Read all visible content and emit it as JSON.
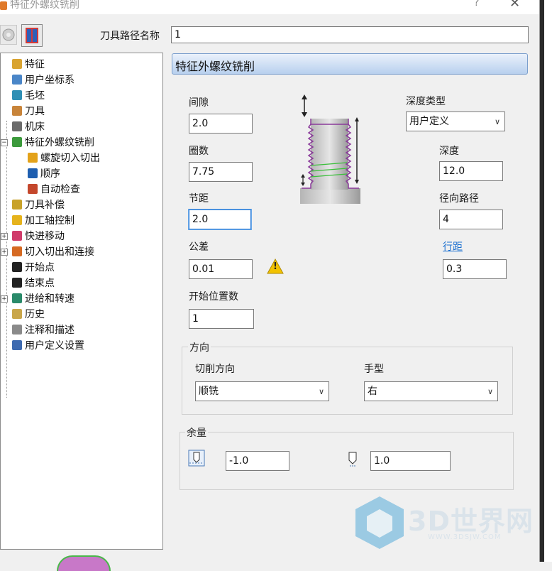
{
  "window": {
    "title": "特征外螺纹铣削",
    "help_glyph": "?",
    "close_glyph": "✕"
  },
  "toolpath_name": {
    "label": "刀具路径名称",
    "value": "1"
  },
  "tree": {
    "items": [
      {
        "label": "特征",
        "icon": "feature-icon",
        "color": "#d9a431"
      },
      {
        "label": "用户坐标系",
        "icon": "ucs-icon",
        "color": "#4a86c8"
      },
      {
        "label": "毛坯",
        "icon": "stock-icon",
        "color": "#2f8fb5"
      },
      {
        "label": "刀具",
        "icon": "tool-icon",
        "color": "#c8843a"
      },
      {
        "label": "机床",
        "icon": "machine-icon",
        "color": "#6b6b6b"
      },
      {
        "label": "特征外螺纹铣削",
        "icon": "thread-milling-icon",
        "color": "#3c9a3c"
      },
      {
        "label": "螺旋切入切出",
        "icon": "helix-lead-icon",
        "color": "#e3a21a"
      },
      {
        "label": "顺序",
        "icon": "order-icon",
        "color": "#1f5fb0"
      },
      {
        "label": "自动检查",
        "icon": "auto-check-icon",
        "color": "#c4472c"
      },
      {
        "label": "刀具补偿",
        "icon": "tool-comp-icon",
        "color": "#c8a22a"
      },
      {
        "label": "加工轴控制",
        "icon": "axis-control-icon",
        "color": "#e6b31c"
      },
      {
        "label": "快进移动",
        "icon": "rapid-move-icon",
        "color": "#d03b6a"
      },
      {
        "label": "切入切出和连接",
        "icon": "leads-links-icon",
        "color": "#d66a22"
      },
      {
        "label": "开始点",
        "icon": "start-point-icon",
        "color": "#222222"
      },
      {
        "label": "结束点",
        "icon": "end-point-icon",
        "color": "#222222"
      },
      {
        "label": "进给和转速",
        "icon": "feeds-speeds-icon",
        "color": "#2a8a6a"
      },
      {
        "label": "历史",
        "icon": "history-icon",
        "color": "#c9a64a"
      },
      {
        "label": "注释和描述",
        "icon": "notes-icon",
        "color": "#8a8a8a"
      },
      {
        "label": "用户定义设置",
        "icon": "user-settings-icon",
        "color": "#3d6ab0"
      }
    ]
  },
  "panel": {
    "header": "特征外螺纹铣削",
    "clearance": {
      "label": "间隙",
      "value": "2.0"
    },
    "turns": {
      "label": "圈数",
      "value": "7.75"
    },
    "pitch": {
      "label": "节距",
      "value": "2.0"
    },
    "tolerance": {
      "label": "公差",
      "value": "0.01"
    },
    "start_positions": {
      "label": "开始位置数",
      "value": "1"
    },
    "depth_type": {
      "label": "深度类型",
      "value": "用户定义"
    },
    "depth": {
      "label": "深度",
      "value": "12.0"
    },
    "radial_paths": {
      "label": "径向路径",
      "value": "4"
    },
    "stepover": {
      "label": "行距",
      "value": "0.3"
    },
    "direction_group": {
      "title": "方向",
      "cut_direction": {
        "label": "切削方向",
        "value": "顺铣"
      },
      "handedness": {
        "label": "手型",
        "value": "右"
      }
    },
    "allowance_group": {
      "title": "余量",
      "radial_allowance": "-1.0",
      "axial_allowance": "1.0"
    },
    "warning_glyph": "!"
  },
  "watermark": {
    "text": "3D世界网",
    "url": "WWW.3DSJW.COM"
  }
}
